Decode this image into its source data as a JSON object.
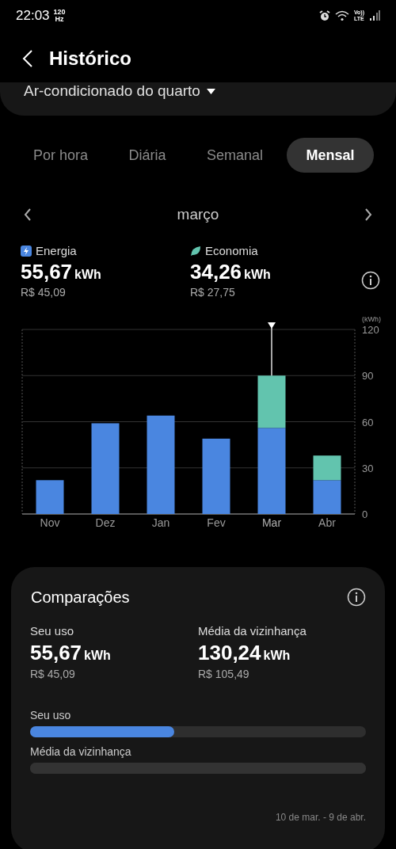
{
  "status_bar": {
    "time": "22:03",
    "refresh_rate": "120",
    "refresh_unit": "Hz",
    "network_top": "Vo))",
    "network_bottom": "LTE"
  },
  "header": {
    "title": "Histórico"
  },
  "device_selector": {
    "label": "Ar-condicionado do quarto"
  },
  "tabs": [
    {
      "label": "Por hora",
      "selected": false
    },
    {
      "label": "Diária",
      "selected": false
    },
    {
      "label": "Semanal",
      "selected": false
    },
    {
      "label": "Mensal",
      "selected": true
    }
  ],
  "period": {
    "label": "março"
  },
  "metrics": [
    {
      "kind": "energy",
      "value": "55,67",
      "unit": "kWh",
      "cost": "R$ 45,09"
    },
    {
      "kind": "savings",
      "value": "34,26",
      "unit": "kWh",
      "cost": "R$ 27,75"
    }
  ],
  "chart": {
    "bars": [
      {
        "selected": false
      },
      {
        "selected": false
      },
      {
        "selected": false
      },
      {
        "selected": false
      },
      {
        "selected": true
      },
      {
        "selected": false
      }
    ],
    "chart_data": {
      "type": "bar",
      "stacked": true,
      "grid": true,
      "ylabel": "(kWh)",
      "categories": [
        "Nov",
        "Dez",
        "Jan",
        "Fev",
        "Mar",
        "Abr"
      ],
      "ylim": [
        0,
        120
      ],
      "yticks": [
        0,
        30,
        60,
        90,
        120
      ],
      "series": [
        {
          "name": "Energia",
          "color": "#4a86e0",
          "values": [
            22,
            59,
            64,
            49,
            56,
            22
          ]
        },
        {
          "name": "Economia",
          "color": "#62c4ae",
          "values": [
            null,
            null,
            null,
            null,
            34,
            16
          ]
        }
      ]
    }
  },
  "comparisons": {
    "title": "Comparações",
    "stats": [
      {
        "label": "Seu uso",
        "value": "55,67",
        "unit": "kWh",
        "cost": "R$ 45,09"
      },
      {
        "label": "Média da vizinhança",
        "value": "130,24",
        "unit": "kWh",
        "cost": "R$ 105,49"
      }
    ],
    "bars": [
      {
        "label": "Seu uso",
        "level": 0.43,
        "color": "#4a86e0"
      },
      {
        "label": "Média da vizinhança",
        "level": 1,
        "color": "#333333"
      }
    ],
    "date_range": "10 de mar. - 9 de abr."
  }
}
